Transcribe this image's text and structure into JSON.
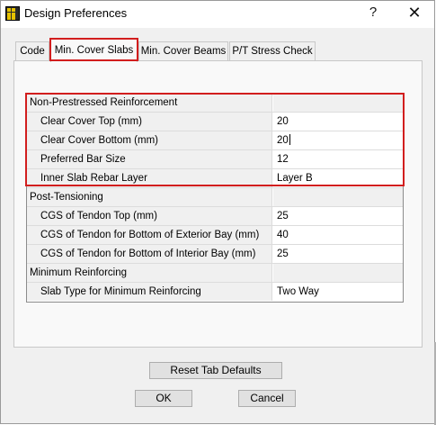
{
  "window": {
    "title": "Design Preferences",
    "help_glyph": "?",
    "close_glyph": "✕",
    "icon": "app-grid-icon"
  },
  "tabs": [
    {
      "label": "Code",
      "active": false
    },
    {
      "label": "Min. Cover Slabs",
      "active": true
    },
    {
      "label": "Min. Cover Beams",
      "active": false
    },
    {
      "label": "P/T Stress Check",
      "active": false
    }
  ],
  "grid": {
    "rows": [
      {
        "label": "Non-Prestressed Reinforcement",
        "value": "",
        "section": true
      },
      {
        "label": "Clear Cover Top  (mm)",
        "value": "20",
        "section": false
      },
      {
        "label": "Clear Cover Bottom  (mm)",
        "value": "20",
        "section": false,
        "editing": true
      },
      {
        "label": "Preferred Bar Size",
        "value": "12",
        "section": false
      },
      {
        "label": "Inner Slab Rebar Layer",
        "value": "Layer B",
        "section": false
      },
      {
        "label": "Post-Tensioning",
        "value": "",
        "section": true
      },
      {
        "label": "CGS of Tendon Top  (mm)",
        "value": "25",
        "section": false
      },
      {
        "label": "CGS of Tendon for Bottom of Exterior Bay  (mm)",
        "value": "40",
        "section": false
      },
      {
        "label": "CGS of Tendon for Bottom of Interior Bay  (mm)",
        "value": "25",
        "section": false
      },
      {
        "label": "Minimum Reinforcing",
        "value": "",
        "section": true
      },
      {
        "label": "Slab Type for Minimum Reinforcing",
        "value": "Two Way",
        "section": false
      }
    ]
  },
  "buttons": {
    "reset": "Reset Tab Defaults",
    "ok": "OK",
    "cancel": "Cancel"
  },
  "colors": {
    "highlight": "#d21e1e",
    "window_bg": "#f0f0f0"
  }
}
